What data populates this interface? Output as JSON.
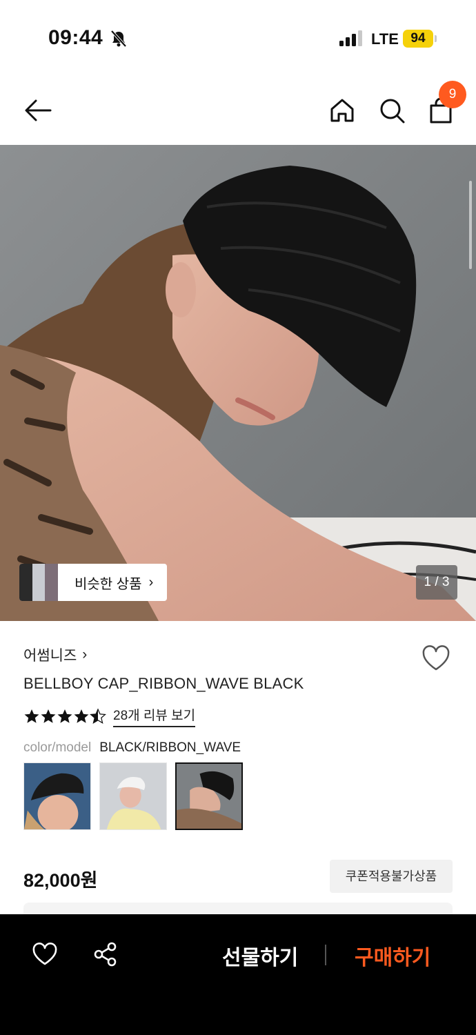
{
  "status_bar": {
    "time": "09:44",
    "network": "LTE",
    "battery": "94"
  },
  "nav": {
    "cart_count": "9"
  },
  "hero": {
    "similar_label": "비슷한 상품",
    "page_counter": "1 / 3"
  },
  "product": {
    "brand": "어썸니즈",
    "title": "BELLBOY CAP_RIBBON_WAVE BLACK",
    "rating": 4.5,
    "review_link": "28개 리뷰 보기",
    "option_label": "color/model",
    "option_value": "BLACK/RIBBON_WAVE",
    "price": "82,000원",
    "coupon_badge": "쿠폰적용불가상품"
  },
  "bottom_bar": {
    "gift_label": "선물하기",
    "buy_label": "구매하기"
  },
  "colors": {
    "accent": "#ff5a1f",
    "bar_bg": "#000000",
    "battery": "#f5d10a"
  },
  "icons": [
    "bell-off-icon",
    "signal-icon",
    "back-arrow-icon",
    "home-icon",
    "search-icon",
    "shopping-bag-icon",
    "chevron-right-icon",
    "heart-icon",
    "star-icon",
    "share-icon"
  ]
}
